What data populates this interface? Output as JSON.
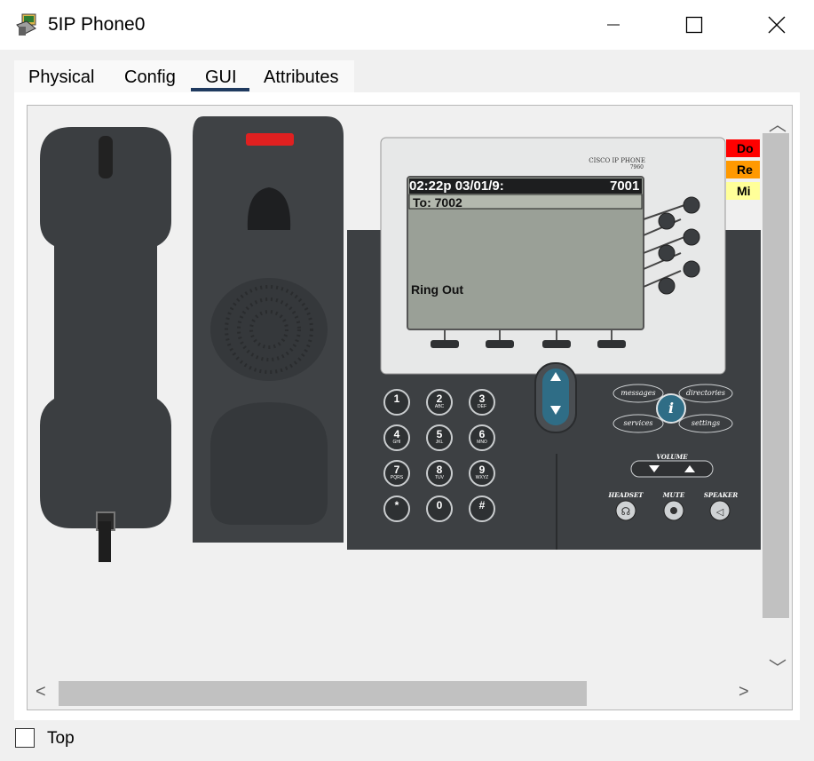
{
  "window": {
    "title": "5IP Phone0",
    "icon": "ip-phone-icon",
    "controls": [
      "minimize-icon",
      "maximize-icon",
      "close-icon"
    ]
  },
  "tabs": [
    {
      "label": "Physical",
      "active": false
    },
    {
      "label": "Config",
      "active": false
    },
    {
      "label": "GUI",
      "active": true
    },
    {
      "label": "Attributes",
      "active": false
    }
  ],
  "phone": {
    "brand": "CISCO IP PHONE",
    "model": "7960",
    "screen": {
      "time_date": "02:22p 03/01/9:",
      "extension": "7001",
      "line": "To: 7002",
      "status": "Ring Out"
    },
    "keypad": [
      {
        "digit": "1",
        "letters": ""
      },
      {
        "digit": "2",
        "letters": "ABC"
      },
      {
        "digit": "3",
        "letters": "DEF"
      },
      {
        "digit": "4",
        "letters": "GHI"
      },
      {
        "digit": "5",
        "letters": "JKL"
      },
      {
        "digit": "6",
        "letters": "MNO"
      },
      {
        "digit": "7",
        "letters": "PQRS"
      },
      {
        "digit": "8",
        "letters": "TUV"
      },
      {
        "digit": "9",
        "letters": "WXYZ"
      },
      {
        "digit": "*",
        "letters": ""
      },
      {
        "digit": "0",
        "letters": ""
      },
      {
        "digit": "#",
        "letters": ""
      }
    ],
    "function_keys": {
      "messages": "messages",
      "directories": "directories",
      "services": "services",
      "settings": "settings",
      "info": "i"
    },
    "volume_label": "VOLUME",
    "headset_label": "HEADSET",
    "mute_label": "MUTE",
    "speaker_label": "SPEAKER"
  },
  "status_indicators": [
    {
      "label": "Do",
      "color": "#ff0000"
    },
    {
      "label": "Re",
      "color": "#ff9900"
    },
    {
      "label": "Mi",
      "color": "#ffff99"
    }
  ],
  "bottom": {
    "top_checkbox_label": "Top",
    "top_checked": false
  }
}
